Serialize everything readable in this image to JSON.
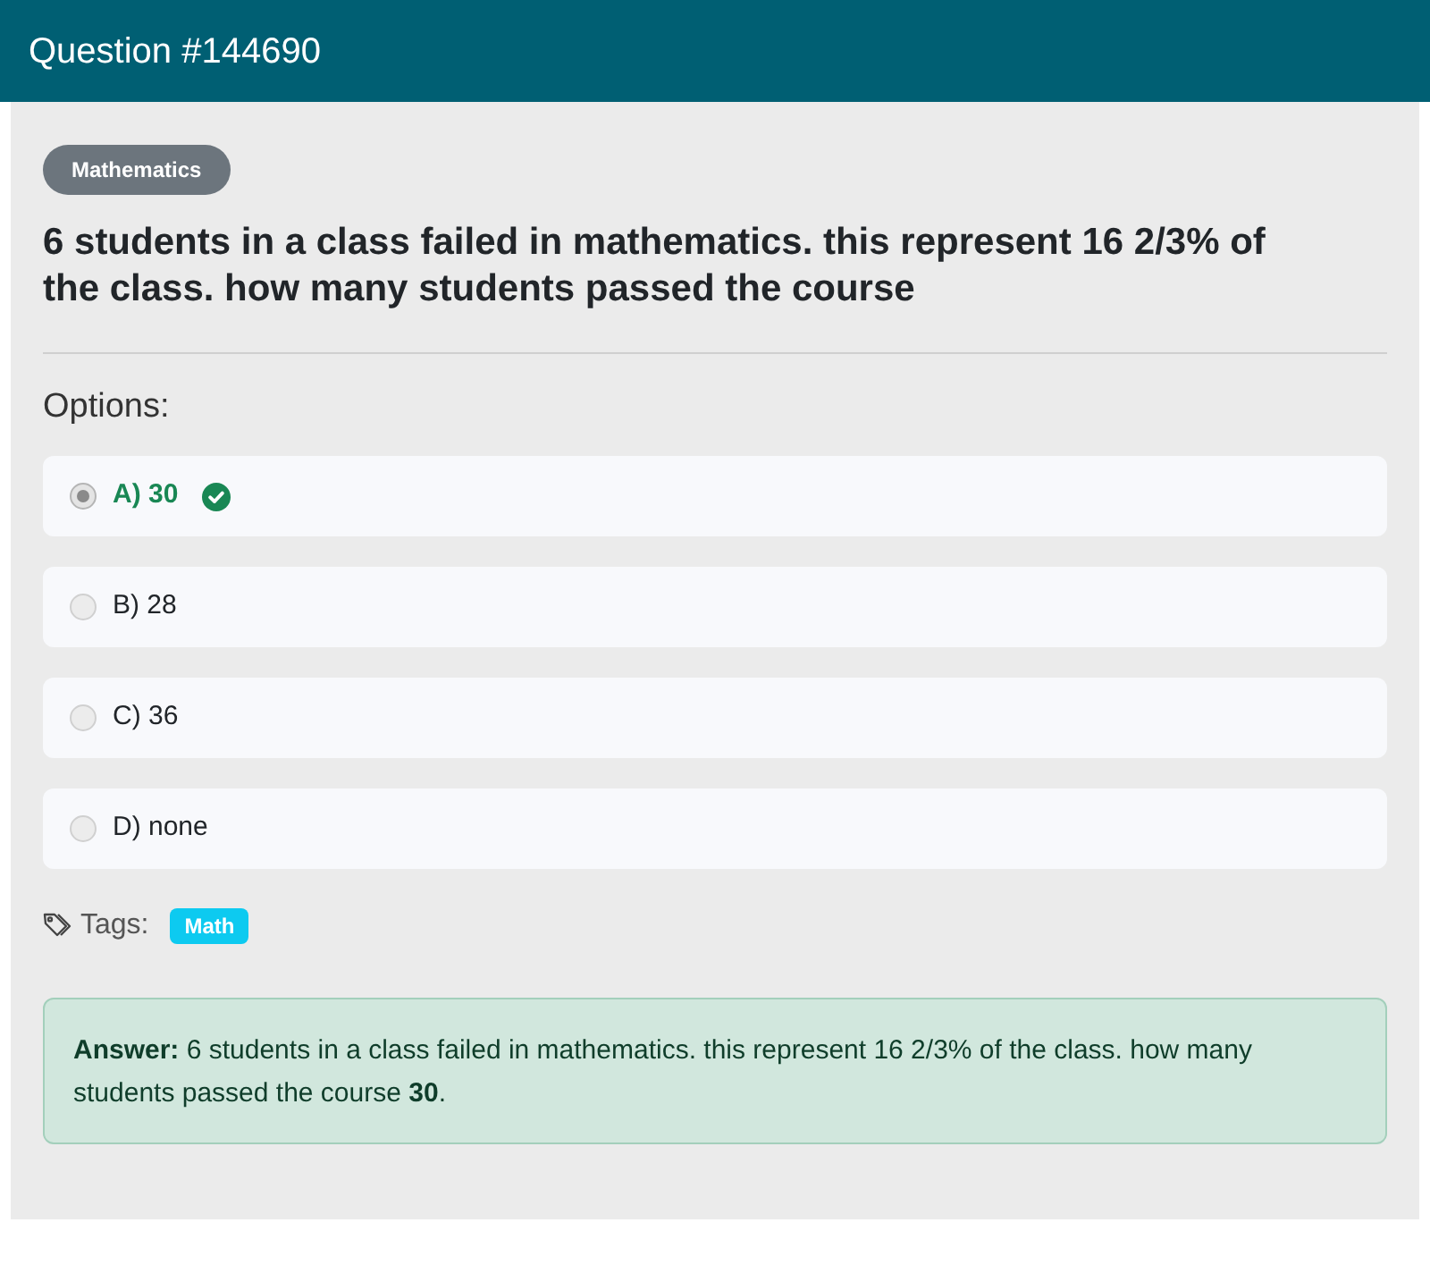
{
  "header": {
    "title": "Question #144690"
  },
  "category_badge": "Mathematics",
  "question": "6 students in a class failed in mathematics. this represent 16 2/3% of the class. how many students passed the course",
  "options_heading": "Options:",
  "options": [
    {
      "label": "A) 30",
      "selected": true,
      "correct": true
    },
    {
      "label": "B) 28",
      "selected": false,
      "correct": false
    },
    {
      "label": "C) 36",
      "selected": false,
      "correct": false
    },
    {
      "label": "D) none",
      "selected": false,
      "correct": false
    }
  ],
  "tags_label": "Tags:",
  "tags": [
    "Math"
  ],
  "answer": "**Answer:** 6 students in a class failed in mathematics. this represent 16 2/3% of the class. how many students passed the course **30**."
}
